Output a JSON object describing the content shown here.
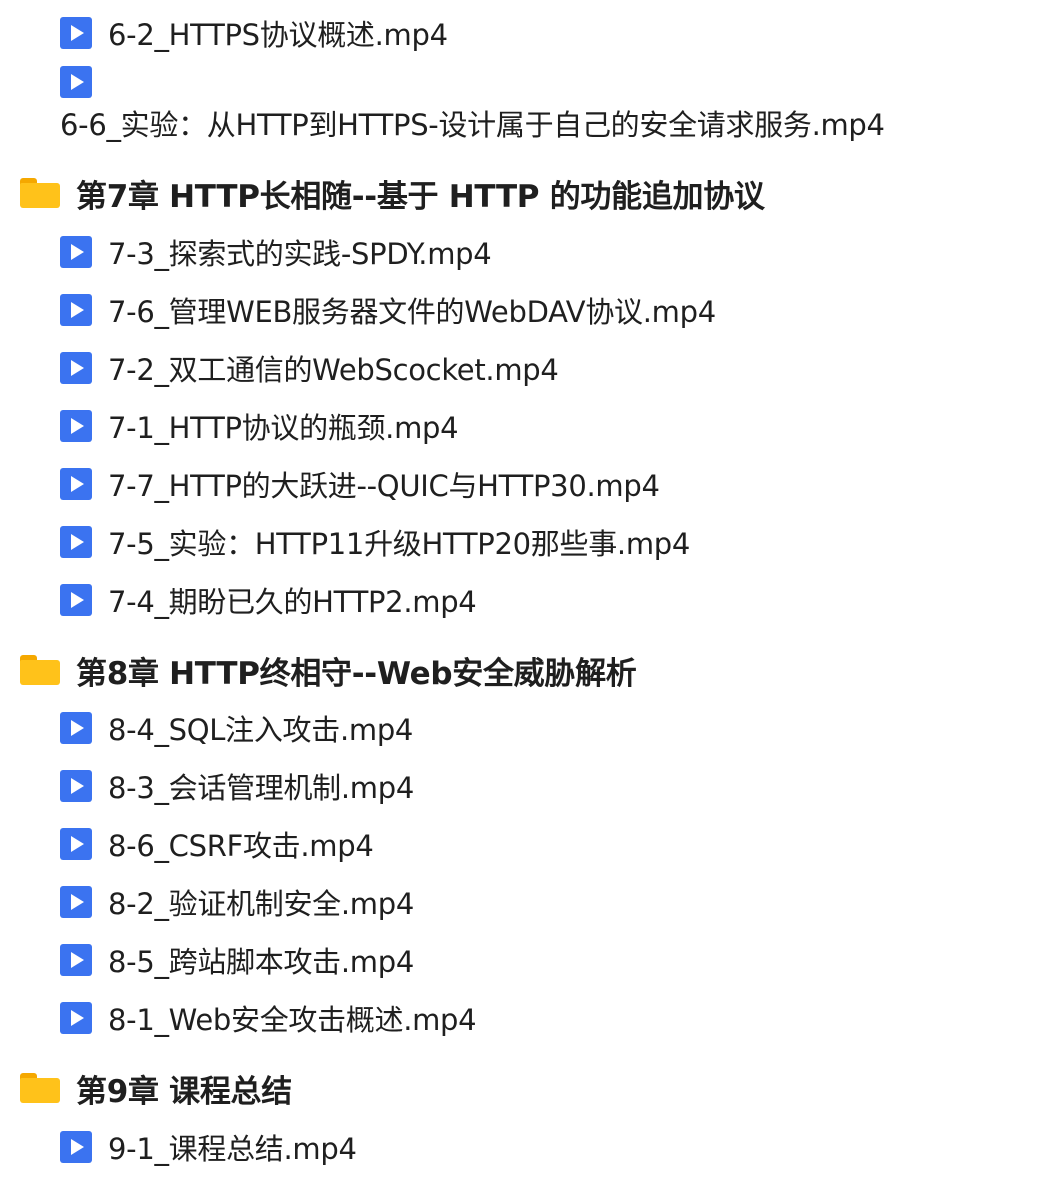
{
  "items": [
    {
      "kind": "file",
      "name": "6-2_HTTPS协议概述.mp4",
      "icon": "play-icon"
    },
    {
      "kind": "file",
      "name": "6-6_实验：从HTTP到HTTPS-设计属于自己的安全请求服务.mp4",
      "icon": "play-icon"
    },
    {
      "kind": "chapter",
      "name": "第7章 HTTP长相随--基于 HTTP 的功能追加协议",
      "icon": "folder-icon"
    },
    {
      "kind": "file",
      "name": "7-3_探索式的实践-SPDY.mp4",
      "icon": "play-icon"
    },
    {
      "kind": "file",
      "name": "7-6_管理WEB服务器文件的WebDAV协议.mp4",
      "icon": "play-icon"
    },
    {
      "kind": "file",
      "name": "7-2_双工通信的WebScocket.mp4",
      "icon": "play-icon"
    },
    {
      "kind": "file",
      "name": "7-1_HTTP协议的瓶颈.mp4",
      "icon": "play-icon"
    },
    {
      "kind": "file",
      "name": "7-7_HTTP的大跃进--QUIC与HTTP30.mp4",
      "icon": "play-icon"
    },
    {
      "kind": "file",
      "name": "7-5_实验：HTTP11升级HTTP20那些事.mp4",
      "icon": "play-icon"
    },
    {
      "kind": "file",
      "name": "7-4_期盼已久的HTTP2.mp4",
      "icon": "play-icon"
    },
    {
      "kind": "chapter",
      "name": "第8章 HTTP终相守--Web安全威胁解析",
      "icon": "folder-icon"
    },
    {
      "kind": "file",
      "name": "8-4_SQL注入攻击.mp4",
      "icon": "play-icon"
    },
    {
      "kind": "file",
      "name": "8-3_会话管理机制.mp4",
      "icon": "play-icon"
    },
    {
      "kind": "file",
      "name": "8-6_CSRF攻击.mp4",
      "icon": "play-icon"
    },
    {
      "kind": "file",
      "name": "8-2_验证机制安全.mp4",
      "icon": "play-icon"
    },
    {
      "kind": "file",
      "name": "8-5_跨站脚本攻击.mp4",
      "icon": "play-icon"
    },
    {
      "kind": "file",
      "name": "8-1_Web安全攻击概述.mp4",
      "icon": "play-icon"
    },
    {
      "kind": "chapter",
      "name": "第9章 课程总结",
      "icon": "folder-icon"
    },
    {
      "kind": "file",
      "name": "9-1_课程总结.mp4",
      "icon": "play-icon"
    }
  ],
  "colors": {
    "play_icon": "#3b73f0",
    "folder_icon": "#ffc21a",
    "text": "#1f1f1f",
    "background": "#ffffff"
  }
}
